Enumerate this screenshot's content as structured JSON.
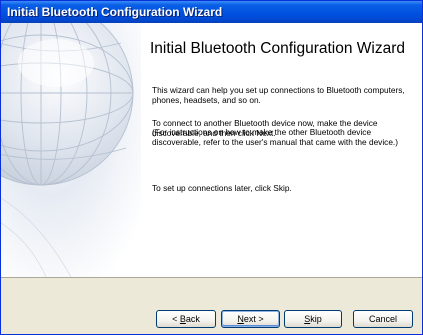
{
  "window": {
    "title": "Initial Bluetooth Configuration Wizard"
  },
  "content": {
    "heading": "Initial Bluetooth Configuration Wizard",
    "paragraph1": "This wizard can help you set up connections to Bluetooth computers, phones, headsets, and so on.",
    "paragraph2": "To connect to another Bluetooth device now, make the device discoverable, and then click Next.",
    "paragraph3": "(For instructions on how to make the other Bluetooth device discoverable, refer to the user's manual that came with the device.)",
    "paragraph4": "To set up connections later, click Skip."
  },
  "buttons": {
    "back": {
      "prefix": "< ",
      "accel": "B",
      "rest": "ack"
    },
    "next": {
      "accel": "N",
      "rest": "ext >"
    },
    "skip": {
      "accel": "S",
      "rest": "kip"
    },
    "cancel": {
      "label": "Cancel"
    }
  },
  "icons": {
    "globe": "globe-watermark-icon"
  },
  "colors": {
    "titlebar": "#0052e0",
    "dialog_bg": "#ece9d8",
    "button_border": "#003c74",
    "default_button_highlight": "#8db2e3"
  }
}
